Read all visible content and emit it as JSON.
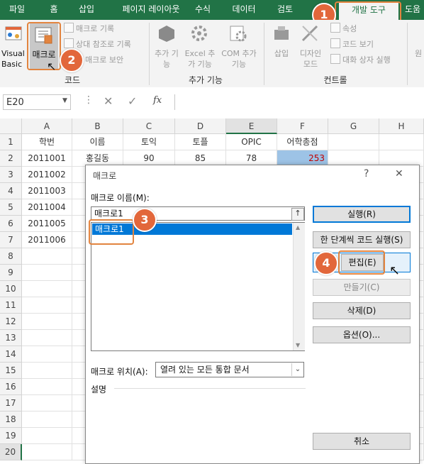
{
  "ribbon_tabs": [
    "파일",
    "홈",
    "삽입",
    "페이지 레이아웃",
    "수식",
    "데이터",
    "검토",
    "개발 도구",
    "도움"
  ],
  "ribbon": {
    "visual_basic": "Visual Basic",
    "macro": "매크로",
    "record_macro": "매크로 기록",
    "relative_ref": "상대 참조로 기록",
    "macro_security": "매크로 보안",
    "code_group": "코드",
    "addins": "추가 기능",
    "excel_addins": "Excel 추가 기능",
    "com_addins": "COM 추가 기능",
    "addins_group": "추가 기능",
    "insert": "삽입",
    "design_mode": "디자인 모드",
    "properties": "속성",
    "view_code": "코드 보기",
    "run_dialog": "대화 상자 실행",
    "controls_group": "컨트롤",
    "far_right": "원"
  },
  "formula_bar": {
    "name_box": "E20",
    "fx": "fx"
  },
  "columns": [
    "A",
    "B",
    "C",
    "D",
    "E",
    "F",
    "G",
    "H"
  ],
  "rows": [
    "1",
    "2",
    "3",
    "4",
    "5",
    "6",
    "7",
    "8",
    "9",
    "10",
    "11",
    "12",
    "13",
    "14",
    "15",
    "16",
    "17",
    "18",
    "19",
    "20"
  ],
  "headers": [
    "학번",
    "이름",
    "토익",
    "토플",
    "OPIC",
    "어학총점"
  ],
  "row2": [
    "2011001",
    "홍길동",
    "90",
    "85",
    "78",
    "253"
  ],
  "col_a": [
    "2011002",
    "2011003",
    "2011004",
    "2011005",
    "2011006"
  ],
  "dialog": {
    "title": "매크로",
    "help": "?",
    "close": "✕",
    "name_label": "매크로 이름(M):",
    "name_value": "매크로1",
    "list_items": [
      "매크로1"
    ],
    "buttons": {
      "run": "실행(R)",
      "step": "한 단계씩 코드 실행(S)",
      "edit": "편집(E)",
      "create": "만들기(C)",
      "delete": "삭제(D)",
      "options": "옵션(O)...",
      "cancel": "취소"
    },
    "location_label": "매크로 위치(A):",
    "location_value": "열려 있는 모든 통합 문서",
    "description_label": "설명"
  },
  "badges": [
    "1",
    "2",
    "3",
    "4"
  ],
  "colors": {
    "excel_green": "#217346",
    "badge": "#e2673b",
    "highlight": "#e2843f",
    "selection": "#0078d7"
  }
}
